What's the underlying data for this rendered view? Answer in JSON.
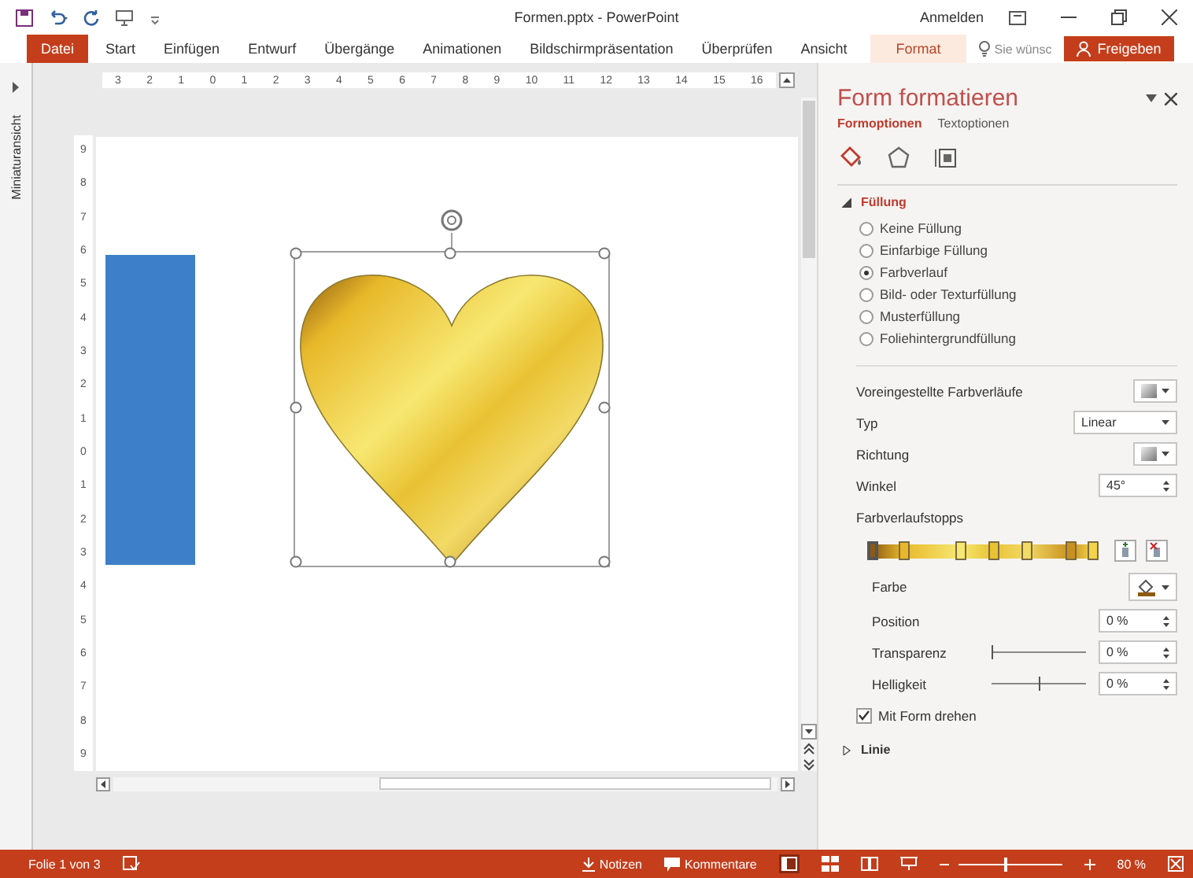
{
  "title_bar": {
    "title": "Formen.pptx - PowerPoint",
    "sign_in": "Anmelden"
  },
  "ribbon": {
    "tabs": [
      {
        "label": "Datei",
        "kind": "file"
      },
      {
        "label": "Start",
        "kind": "normal"
      },
      {
        "label": "Einfügen",
        "kind": "normal"
      },
      {
        "label": "Entwurf",
        "kind": "normal"
      },
      {
        "label": "Übergänge",
        "kind": "normal"
      },
      {
        "label": "Animationen",
        "kind": "normal"
      },
      {
        "label": "Bildschirmpräsentation",
        "kind": "normal"
      },
      {
        "label": "Überprüfen",
        "kind": "normal"
      },
      {
        "label": "Ansicht",
        "kind": "normal"
      },
      {
        "label": "Format",
        "kind": "contextual"
      }
    ],
    "search": {
      "placeholder": "Sie wünsc"
    },
    "share": "Freigeben"
  },
  "thumbnail_strip": {
    "label": "Miniaturansicht",
    "expanded": false
  },
  "horizontal_ruler": [
    "3",
    "2",
    "1",
    "0",
    "1",
    "2",
    "3",
    "4",
    "5",
    "6",
    "7",
    "8",
    "9",
    "10",
    "11",
    "12",
    "13",
    "14",
    "15",
    "16"
  ],
  "vertical_ruler": [
    "9",
    "8",
    "7",
    "6",
    "5",
    "4",
    "3",
    "2",
    "1",
    "0",
    "1",
    "2",
    "3",
    "4",
    "5",
    "6",
    "7",
    "8",
    "9"
  ],
  "slide": {
    "shapes": [
      {
        "kind": "rectangle",
        "color": "#3d7fc9",
        "selected": false
      },
      {
        "kind": "heart",
        "selected": true
      }
    ]
  },
  "pane": {
    "title": "Form formatieren",
    "tabs": [
      {
        "label": "Formoptionen",
        "selected": true
      },
      {
        "label": "Textoptionen",
        "selected": false
      }
    ],
    "category_icons": [
      {
        "kind": "fill",
        "selected": true
      },
      {
        "kind": "effects",
        "selected": false
      },
      {
        "kind": "size",
        "selected": false
      }
    ],
    "fill_section": {
      "title": "Füllung",
      "expanded": true,
      "options": [
        {
          "label": "Keine Füllung",
          "selected": false
        },
        {
          "label": "Einfarbige Füllung",
          "selected": false
        },
        {
          "label": "Farbverlauf",
          "selected": true
        },
        {
          "label": "Bild- oder Texturfüllung",
          "selected": false
        },
        {
          "label": "Musterfüllung",
          "selected": false
        },
        {
          "label": "Foliehintergrundfüllung",
          "selected": false
        }
      ],
      "settings": [
        {
          "kind": "swatch",
          "label": "Voreingestellte Farbverläufe"
        },
        {
          "kind": "dropdown",
          "label": "Typ",
          "value": "Linear"
        },
        {
          "kind": "swatch",
          "label": "Richtung"
        },
        {
          "kind": "spinner",
          "label": "Winkel",
          "value": "45°"
        },
        {
          "kind": "heading",
          "label": "Farbverlaufstopps"
        },
        {
          "kind": "stops",
          "stops": [
            {
              "level": 0.0,
              "color": "#8c5a12",
              "selected": true
            },
            {
              "level": 0.14,
              "color": "#e8b82a",
              "selected": false
            },
            {
              "level": 0.4,
              "color": "#f7e872",
              "selected": false
            },
            {
              "level": 0.55,
              "color": "#e9c233",
              "selected": false
            },
            {
              "level": 0.7,
              "color": "#f2da66",
              "selected": false
            },
            {
              "level": 0.9,
              "color": "#c8901e",
              "selected": false
            },
            {
              "level": 1.0,
              "color": "#f3d44a",
              "selected": false
            }
          ]
        },
        {
          "kind": "color",
          "label": "Farbe"
        },
        {
          "kind": "spinner",
          "label": "Position",
          "value": "0 %"
        },
        {
          "kind": "slider",
          "label": "Transparenz",
          "level": 0,
          "value": "0 %"
        },
        {
          "kind": "slider",
          "label": "Helligkeit",
          "level": 0.5,
          "value": "0 %"
        },
        {
          "kind": "checkbox",
          "label": "Mit Form drehen",
          "checked": true
        }
      ]
    },
    "line_section": {
      "title": "Linie",
      "expanded": false
    }
  },
  "status_bar": {
    "slide_info": "Folie 1 von 3",
    "notes": "Notizen",
    "comments": "Kommentare",
    "zoom": "80 %"
  },
  "zoom_slider": {
    "level": 0.45
  }
}
